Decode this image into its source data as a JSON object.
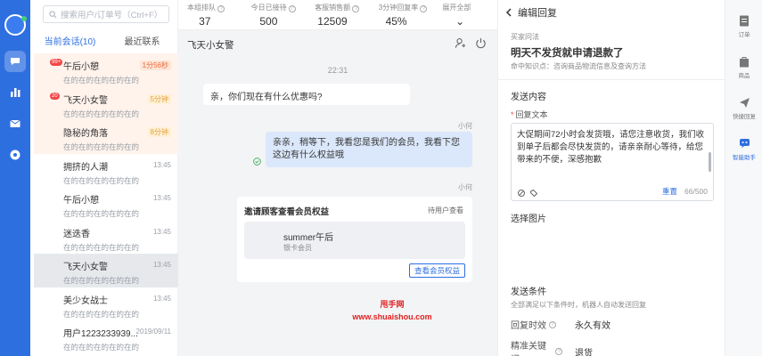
{
  "search": {
    "placeholder": "搜索用户/订单号（Ctrl+F）"
  },
  "tabs": [
    {
      "label": "当前会话(10)"
    },
    {
      "label": "最近联系"
    }
  ],
  "sessions": [
    {
      "name": "午后小憩",
      "message": "在的在的在的在的在的",
      "time": "1分56秒",
      "badge": "99+",
      "style": "hl-tag"
    },
    {
      "name": "飞天小女警",
      "message": "在的在的在的在的在的",
      "time": "5分钟",
      "badge": "20",
      "style": "tag2"
    },
    {
      "name": "隐秘的角落",
      "message": "在的在的在的在的在的",
      "time": "8分钟",
      "badge": "",
      "style": "tag2"
    },
    {
      "name": "拥挤的人潮",
      "message": "在的在的在的在的在的",
      "time": "13:45",
      "badge": "",
      "style": ""
    },
    {
      "name": "午后小憩",
      "message": "在的在的在的在的在的",
      "time": "13:45",
      "badge": "",
      "style": ""
    },
    {
      "name": "迷迭香",
      "message": "在的在的在的在的在的",
      "time": "13:45",
      "badge": "",
      "style": ""
    },
    {
      "name": "飞天小女警",
      "message": "在的在的在的在的在的",
      "time": "13:45",
      "badge": "",
      "style": "sel"
    },
    {
      "name": "美少女战士",
      "message": "在的在的在的在的在的",
      "time": "13:45",
      "badge": "",
      "style": ""
    },
    {
      "name": "用户1223233939...",
      "message": "在的在的在的在的在的",
      "time": "2019/09/11",
      "badge": "",
      "style": ""
    }
  ],
  "stats": [
    {
      "label": "本组排队",
      "value": "37"
    },
    {
      "label": "今日已接待",
      "value": "500"
    },
    {
      "label": "客服销售额",
      "value": "12509"
    },
    {
      "label": "3分钟回复率",
      "value": "45%"
    },
    {
      "label": "展开全部",
      "value": ""
    }
  ],
  "chat": {
    "title": "飞天小女警",
    "time": "22:31",
    "incoming": "亲，你们现在有什么优惠吗?",
    "sender1": "小何",
    "outgoing": "亲亲，稍等下，我看您是我们的会员，我看下您这边有什么权益哦",
    "sender2": "小何",
    "card": {
      "title": "邀请顾客查看会员权益",
      "status": "待用户查看",
      "name": "summer午后",
      "level": "银卡会员",
      "button": "查看会员权益"
    }
  },
  "watermark": {
    "line1": "甩手网",
    "line2": "www.shuaishou.com"
  },
  "editor": {
    "title": "编辑回复",
    "question_label": "买家问法",
    "question": "明天不发货就申请退款了",
    "knowledge": "命中知识点：咨询商品物流信息及查询方法",
    "send_content": "发送内容",
    "reply_label": "回复文本",
    "reply_text": "大促期间72小时会发货哦，请您注意收货，我们收到单子后都会尽快发货的，请亲亲耐心等待，给您带来的不便，深感抱歉",
    "reset": "重置",
    "count": "66/500",
    "choose_image": "选择图片",
    "send_condition": "发送条件",
    "condition_desc": "全部满足以下条件时，机器人自动发送回复",
    "validity_label": "回复时效",
    "validity_value": "永久有效",
    "keyword_label": "精准关键词",
    "keyword_value": "退货"
  },
  "tools": [
    {
      "label": "订单",
      "icon": "order-icon"
    },
    {
      "label": "商品",
      "icon": "goods-icon"
    },
    {
      "label": "快捷回复",
      "icon": "send-icon"
    },
    {
      "label": "智能助手",
      "icon": "robot-icon"
    }
  ],
  "colors": {
    "primary": "#2e6fe0",
    "warning": "#f06a3a",
    "watermark": "#e02020"
  }
}
